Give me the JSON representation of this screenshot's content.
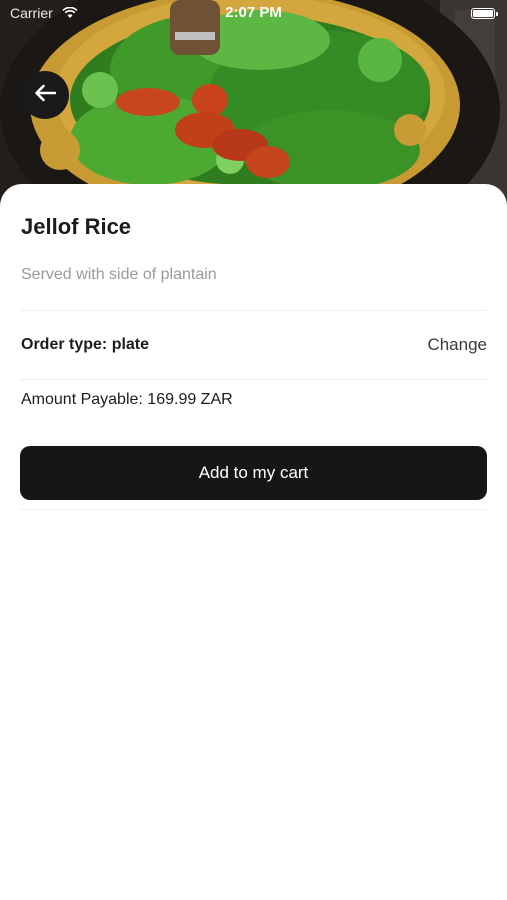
{
  "status_bar": {
    "carrier": "Carrier",
    "time": "2:07 PM"
  },
  "hero": {
    "image": "jellof-rice-dish-photo"
  },
  "back_button": {
    "icon": "arrow-left-icon"
  },
  "product": {
    "title": "Jellof Rice",
    "description": "Served with side of plantain"
  },
  "order": {
    "type_label": "Order type: plate",
    "change_label": "Change"
  },
  "payment": {
    "amount_text": "Amount Payable: 169.99 ZAR"
  },
  "cart": {
    "button_label": "Add to my cart"
  },
  "colors": {
    "button_background": "#161616",
    "button_text": "#ffffff",
    "subtitle_text": "#9a9a9a",
    "divider": "#eeeeee"
  }
}
